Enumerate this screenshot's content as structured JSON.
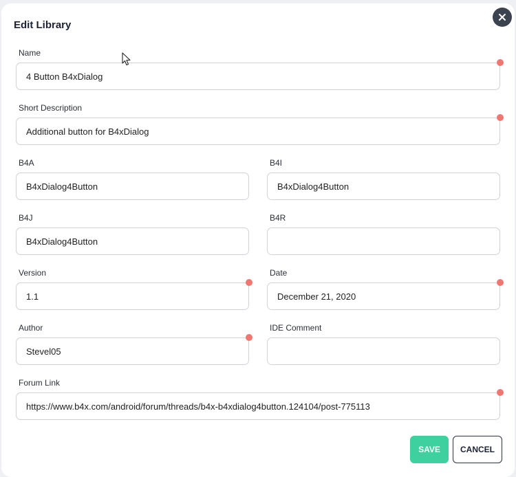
{
  "dialog": {
    "title": "Edit Library",
    "close_icon": "close-icon"
  },
  "fields": {
    "name": {
      "label": "Name",
      "value": "4 Button B4xDialog",
      "required": true
    },
    "short_description": {
      "label": "Short Description",
      "value": "Additional button for B4xDialog",
      "required": true
    },
    "b4a": {
      "label": "B4A",
      "value": "B4xDialog4Button"
    },
    "b4i": {
      "label": "B4I",
      "value": "B4xDialog4Button"
    },
    "b4j": {
      "label": "B4J",
      "value": "B4xDialog4Button"
    },
    "b4r": {
      "label": "B4R",
      "value": ""
    },
    "version": {
      "label": "Version",
      "value": "1.1",
      "required": true
    },
    "date": {
      "label": "Date",
      "value": "December 21, 2020",
      "required": true
    },
    "author": {
      "label": "Author",
      "value": "Stevel05",
      "required": true
    },
    "ide_comment": {
      "label": "IDE Comment",
      "value": ""
    },
    "forum_link": {
      "label": "Forum Link",
      "value": "https://www.b4x.com/android/forum/threads/b4x-b4xdialog4button.124104/post-775113",
      "required": true
    }
  },
  "actions": {
    "save_label": "SAVE",
    "cancel_label": "CANCEL"
  },
  "colors": {
    "accent": "#3fd0a0",
    "required_dot": "#f0766f",
    "close_bg": "#3c4350"
  }
}
